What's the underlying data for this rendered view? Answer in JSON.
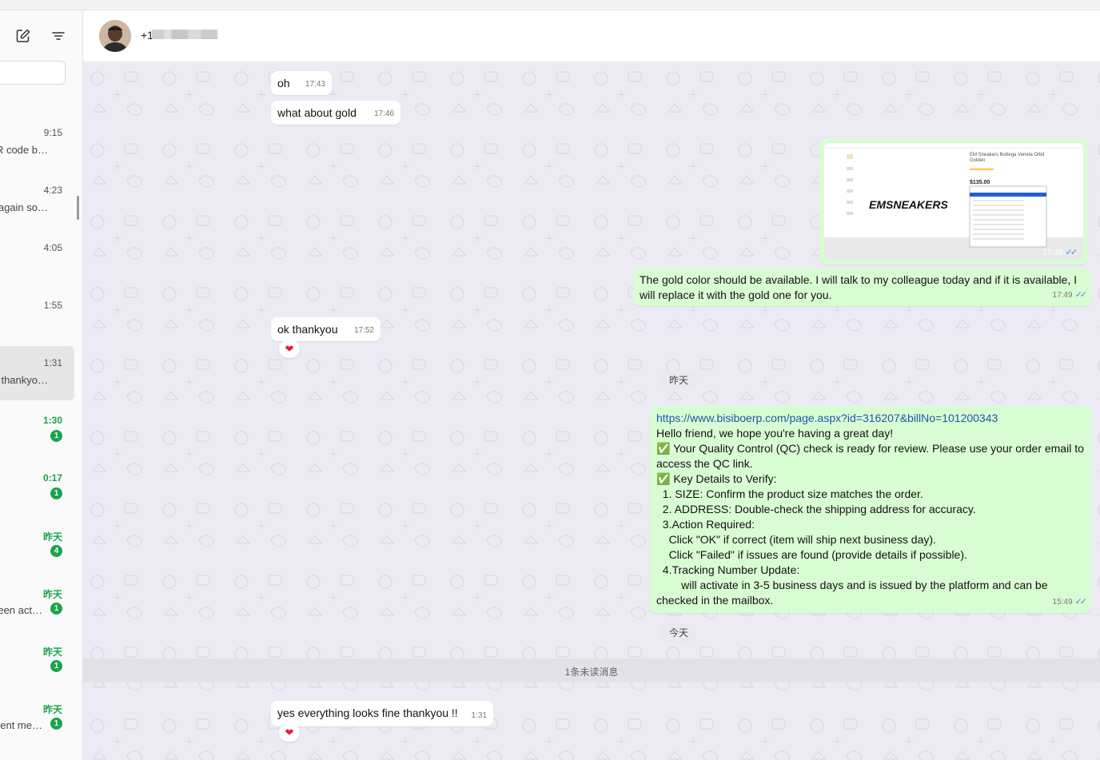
{
  "sidebar": {
    "chats": [
      {
        "time": "9:15",
        "preview": "R code b…",
        "unread": null,
        "time_unread": false
      },
      {
        "time": "4:23",
        "preview": "again so…",
        "unread": null,
        "time_unread": false
      },
      {
        "time": "4:05",
        "preview": "",
        "unread": null,
        "time_unread": false
      },
      {
        "time": "1:55",
        "preview": "",
        "unread": null,
        "time_unread": false
      },
      {
        "time": "1:31",
        "preview": "thankyo…",
        "unread": null,
        "time_unread": false
      },
      {
        "time": "1:30",
        "preview": "",
        "unread": "1",
        "time_unread": true
      },
      {
        "time": "0:17",
        "preview": "",
        "unread": "1",
        "time_unread": true
      },
      {
        "time": "昨天",
        "preview": "",
        "unread": "4",
        "time_unread": true
      },
      {
        "time": "昨天",
        "preview": "een act…",
        "unread": "1",
        "time_unread": true
      },
      {
        "time": "昨天",
        "preview": "",
        "unread": "1",
        "time_unread": true
      },
      {
        "time": "昨天",
        "preview": "ent me…",
        "unread": "1",
        "time_unread": true
      }
    ]
  },
  "header": {
    "contact_prefix": "+1"
  },
  "messages": {
    "m1": {
      "text": "oh",
      "time": "17:43"
    },
    "m2": {
      "text": "what about gold",
      "time": "17:46"
    },
    "m3": {
      "time": "17:49",
      "brand": "EMSNEAKERS",
      "product_title": "EM Sneakers Bottega Veneta Orbit Golden",
      "price": "$135.00"
    },
    "m4": {
      "text": "The gold color should be available. I will talk to my colleague today and if it is available, I will replace it with the gold one for you.",
      "time": "17:49"
    },
    "m5": {
      "text": "ok thankyou",
      "time": "17:52",
      "reaction": "❤"
    },
    "date1": "昨天",
    "m6": {
      "link": "https://www.bisiboerp.com/page.aspx?id=316207&billNo=101200343",
      "lines": [
        "Hello friend, we hope you're having a great day!",
        "✅ Your Quality Control (QC) check is ready for review. Please use your order email to access the QC link.",
        "✅ Key Details to Verify:",
        "  1. SIZE: Confirm the product size matches the order.",
        "  2. ADDRESS: Double-check the shipping address for accuracy.",
        "  3.Action Required:",
        "    Click \"OK\" if correct (item will ship next business day).",
        "    Click \"Failed\" if issues are found (provide details if possible).",
        "  4.Tracking Number Update:",
        "        will activate in 3-5 business days and is issued by the platform and can be checked in the mailbox."
      ],
      "time": "15:49"
    },
    "date2": "今天",
    "unread_divider": "1条未读消息",
    "m7": {
      "text": "yes everything looks fine thankyou !!",
      "time": "1:31",
      "reaction": "❤"
    }
  },
  "colors": {
    "incoming": "#ffffff",
    "outgoing": "#d9fdd3",
    "unread_green": "#1aa34a",
    "read_tick": "#3a8ee6",
    "background": "#ecebf3"
  }
}
